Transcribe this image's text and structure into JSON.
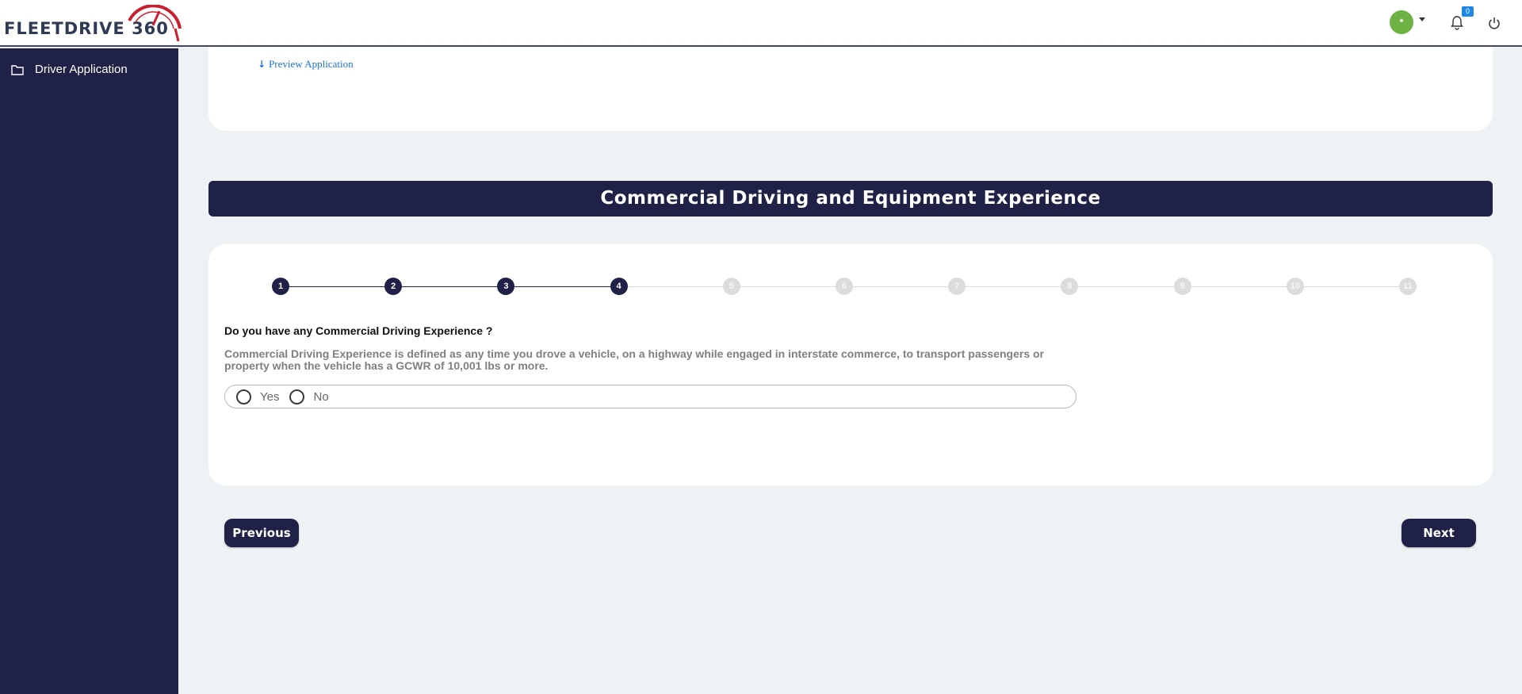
{
  "header": {
    "logo_text": "FLEETDRIVE 360",
    "avatar_initial": "*",
    "notification_count": "0"
  },
  "sidebar": {
    "items": [
      {
        "label": "Driver Application",
        "icon": "folder-icon"
      }
    ]
  },
  "top_card": {
    "preview_link": "Preview Application"
  },
  "section": {
    "title": "Commercial Driving and Equipment Experience"
  },
  "stepper": {
    "steps": [
      "1",
      "2",
      "3",
      "4",
      "5",
      "6",
      "7",
      "8",
      "9",
      "10",
      "11"
    ],
    "current_step": 4
  },
  "form": {
    "question": "Do you have any Commercial Driving Experience ?",
    "description": "Commercial Driving Experience is defined as any time you drove a vehicle, on a highway while engaged in interstate commerce, to transport passengers or property when the vehicle has a GCWR of 10,001 lbs or more.",
    "options": [
      "Yes",
      "No"
    ]
  },
  "nav": {
    "previous_label": "Previous",
    "next_label": "Next"
  },
  "colors": {
    "navy": "#1f2147",
    "background": "#eff2f5",
    "link": "#1a73d9",
    "avatar": "#6fb244",
    "badge": "#1e88e5"
  }
}
